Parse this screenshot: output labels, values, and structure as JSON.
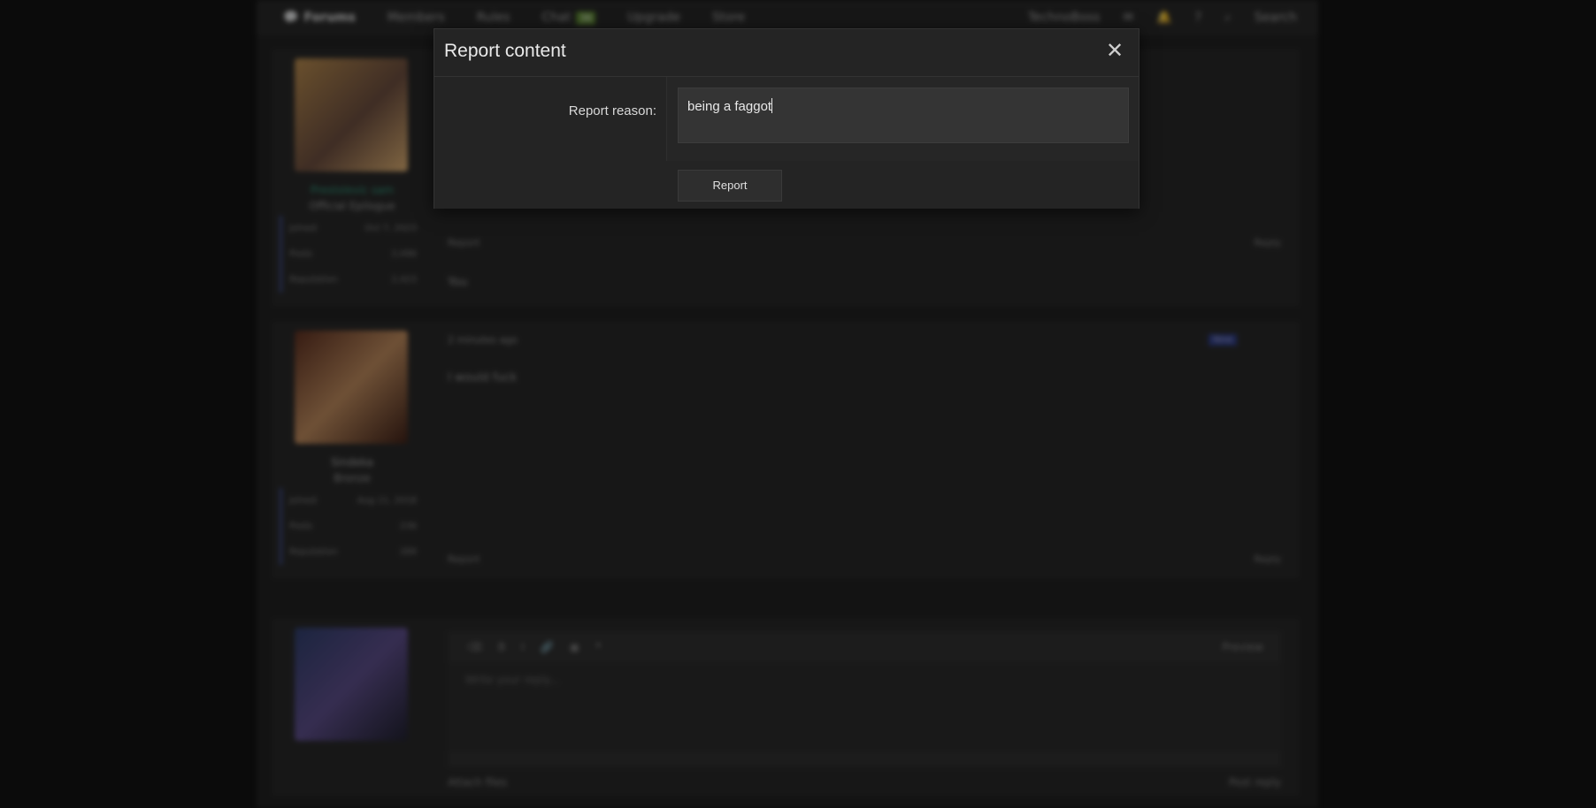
{
  "background": {
    "nav": {
      "items": [
        "Forums",
        "Members",
        "Rules",
        "Chat",
        "Upgrade",
        "Store"
      ],
      "chat_count": "36",
      "user": "TechnoBoss",
      "search": "Search"
    },
    "post1": {
      "username": "Prestolevic sam",
      "title": "Official Epilogue",
      "joined_label": "Joined",
      "joined": "Oct 7, 2023",
      "posts_label": "Posts",
      "posts": "2,096",
      "rep_label": "Reputation",
      "rep": "2,423",
      "report": "Report",
      "reply": "Reply",
      "reaction": "You"
    },
    "post2": {
      "time": "2 minutes ago",
      "new_badge": "New",
      "body": "I would fuck",
      "username": "Sindeka",
      "title": "Bronze",
      "joined_label": "Joined",
      "joined": "Aug 11, 2018",
      "posts_label": "Posts",
      "posts": "236",
      "rep_label": "Reputation",
      "rep": "289",
      "report": "Report",
      "reply": "Reply"
    },
    "editor": {
      "placeholder": "Write your reply...",
      "preview": "Preview",
      "attach": "Attach files",
      "post_reply": "Post reply"
    }
  },
  "modal": {
    "title": "Report content",
    "close_symbol": "✕",
    "reason_label": "Report reason:",
    "reason_value": "being a faggot",
    "submit_label": "Report"
  },
  "colors": {
    "modal_bg": "#242424",
    "input_bg": "#343434",
    "page_bg": "#0b0b0b"
  }
}
